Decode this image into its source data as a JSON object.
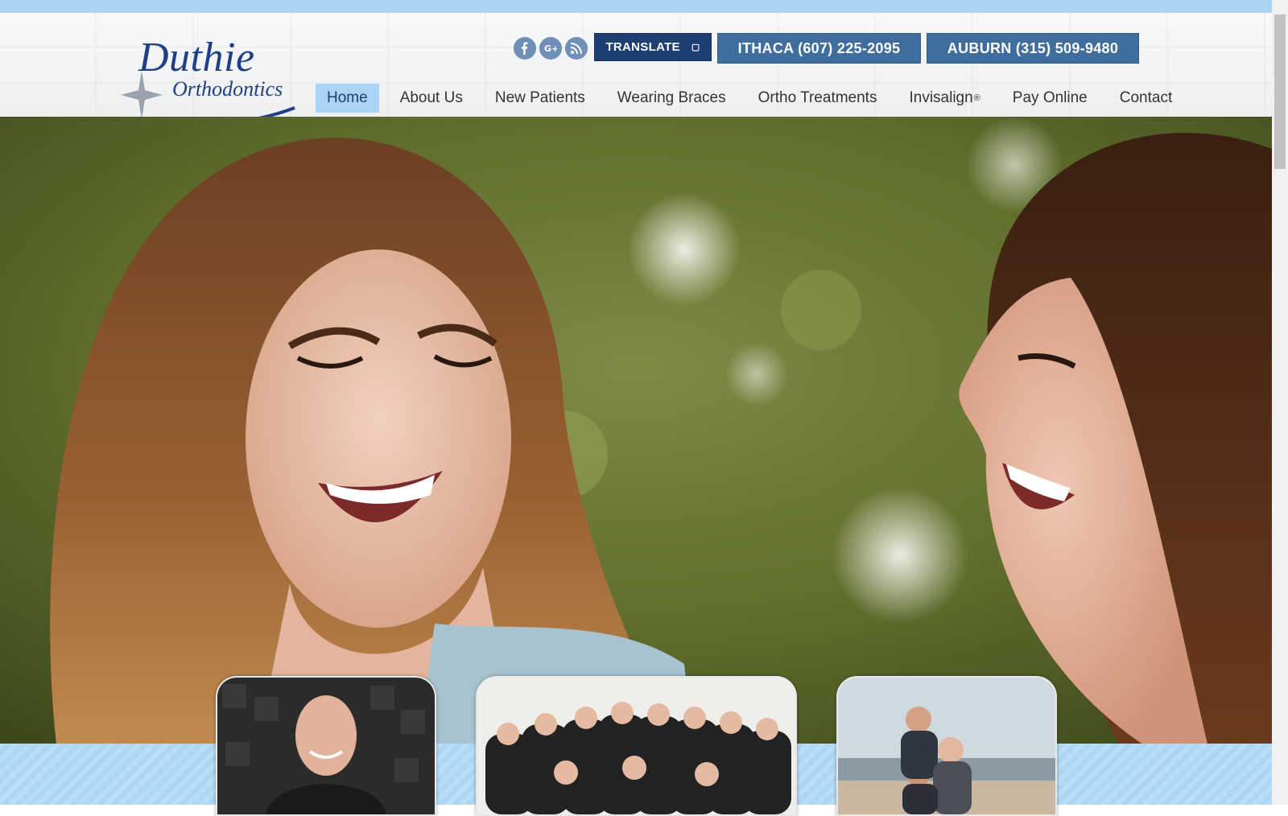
{
  "brand": {
    "name": "Duthie",
    "subtitle": "Orthodontics",
    "color": "#1f3f86"
  },
  "social": [
    {
      "icon": "facebook-icon",
      "glyph": "f"
    },
    {
      "icon": "google-plus-icon",
      "glyph": "G+"
    },
    {
      "icon": "rss-icon",
      "glyph": "rss"
    }
  ],
  "header": {
    "translate_label": "TRANSLATE",
    "translate_icon": "dropdown-icon",
    "phone_ithaca": "ITHACA (607) 225-2095",
    "phone_auburn": "AUBURN (315) 509-9480"
  },
  "nav": {
    "items": [
      {
        "label": "Home",
        "active": true
      },
      {
        "label": "About Us"
      },
      {
        "label": "New Patients"
      },
      {
        "label": "Wearing Braces"
      },
      {
        "label": "Ortho Treatments"
      },
      {
        "label": "Invisalign",
        "sup": "®"
      },
      {
        "label": "Pay Online"
      },
      {
        "label": "Contact"
      }
    ]
  },
  "colors": {
    "accent_light": "#a9d4f3",
    "accent_dark": "#1e3f72",
    "phone_button": "#3f6d9e"
  },
  "hero": {
    "description": "hero-photo"
  },
  "cards": [
    {
      "name": "doctor-photo-card"
    },
    {
      "name": "team-photo-card"
    },
    {
      "name": "patients-photo-card"
    }
  ]
}
